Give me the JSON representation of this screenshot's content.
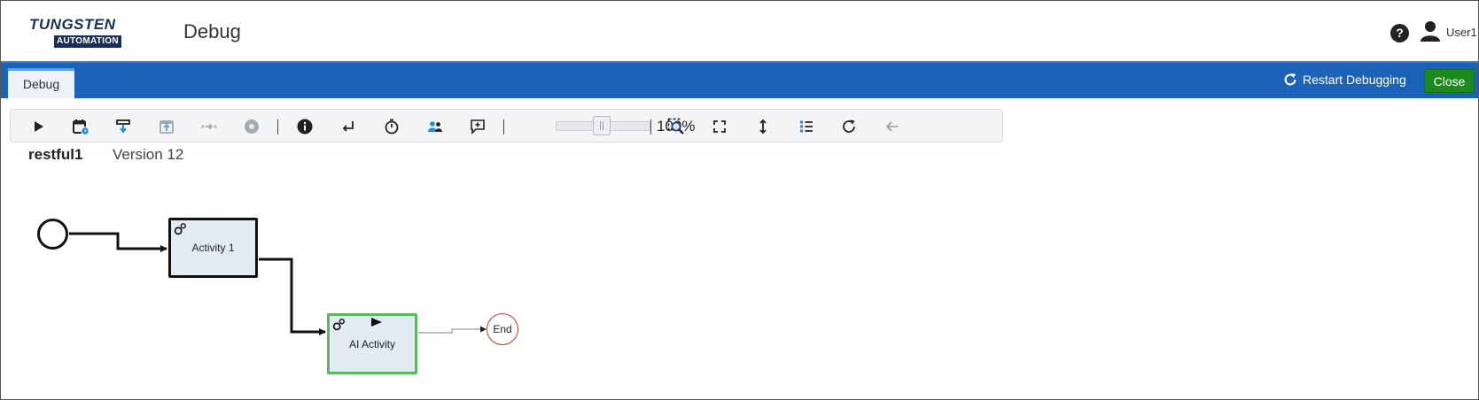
{
  "header": {
    "logo_top": "TUNGSTEN",
    "logo_bottom": "AUTOMATION",
    "title": "Debug",
    "help_symbol": "?",
    "user_name": "User1"
  },
  "tabbar": {
    "tabs": [
      {
        "label": "Debug",
        "active": true
      }
    ],
    "restart_label": "Restart Debugging",
    "close_label": "Close",
    "bar_color": "#1b63b8",
    "close_color": "#1e8a1e"
  },
  "toolbar": {
    "buttons": [
      {
        "icon": "play-icon",
        "enabled": true
      },
      {
        "icon": "calendar-clock-icon",
        "enabled": true
      },
      {
        "icon": "step-into-icon",
        "enabled": true
      },
      {
        "icon": "step-out-icon",
        "enabled": false
      },
      {
        "icon": "step-over-icon",
        "enabled": false
      },
      {
        "icon": "stop-circle-icon",
        "enabled": false
      },
      {
        "icon": "info-icon",
        "enabled": true
      },
      {
        "icon": "return-arrow-icon",
        "enabled": true
      },
      {
        "icon": "stopwatch-icon",
        "enabled": true
      },
      {
        "icon": "users-icon",
        "enabled": true
      },
      {
        "icon": "add-comment-icon",
        "enabled": true
      },
      {
        "icon": "zoom-fit-icon",
        "enabled": true
      },
      {
        "icon": "fullscreen-icon",
        "enabled": true
      },
      {
        "icon": "vertical-resize-icon",
        "enabled": true
      },
      {
        "icon": "list-icon",
        "enabled": true
      },
      {
        "icon": "refresh-icon",
        "enabled": true
      },
      {
        "icon": "back-arrow-icon",
        "enabled": false
      }
    ],
    "zoom": {
      "value_percent": 100,
      "label": "100%"
    }
  },
  "workflow": {
    "name": "restful1",
    "version": "Version 12"
  },
  "diagram": {
    "nodes": [
      {
        "id": "start",
        "type": "start-event",
        "label": ""
      },
      {
        "id": "activity1",
        "type": "activity",
        "label": "Activity 1",
        "state": "completed"
      },
      {
        "id": "ai_activity",
        "type": "activity",
        "label": "AI Activity",
        "state": "current"
      },
      {
        "id": "end",
        "type": "end-event",
        "label": "End"
      }
    ],
    "colors": {
      "current_border": "#5cb85c",
      "end_border": "#c0392b",
      "activity_fill": "#e2eaf3"
    }
  }
}
